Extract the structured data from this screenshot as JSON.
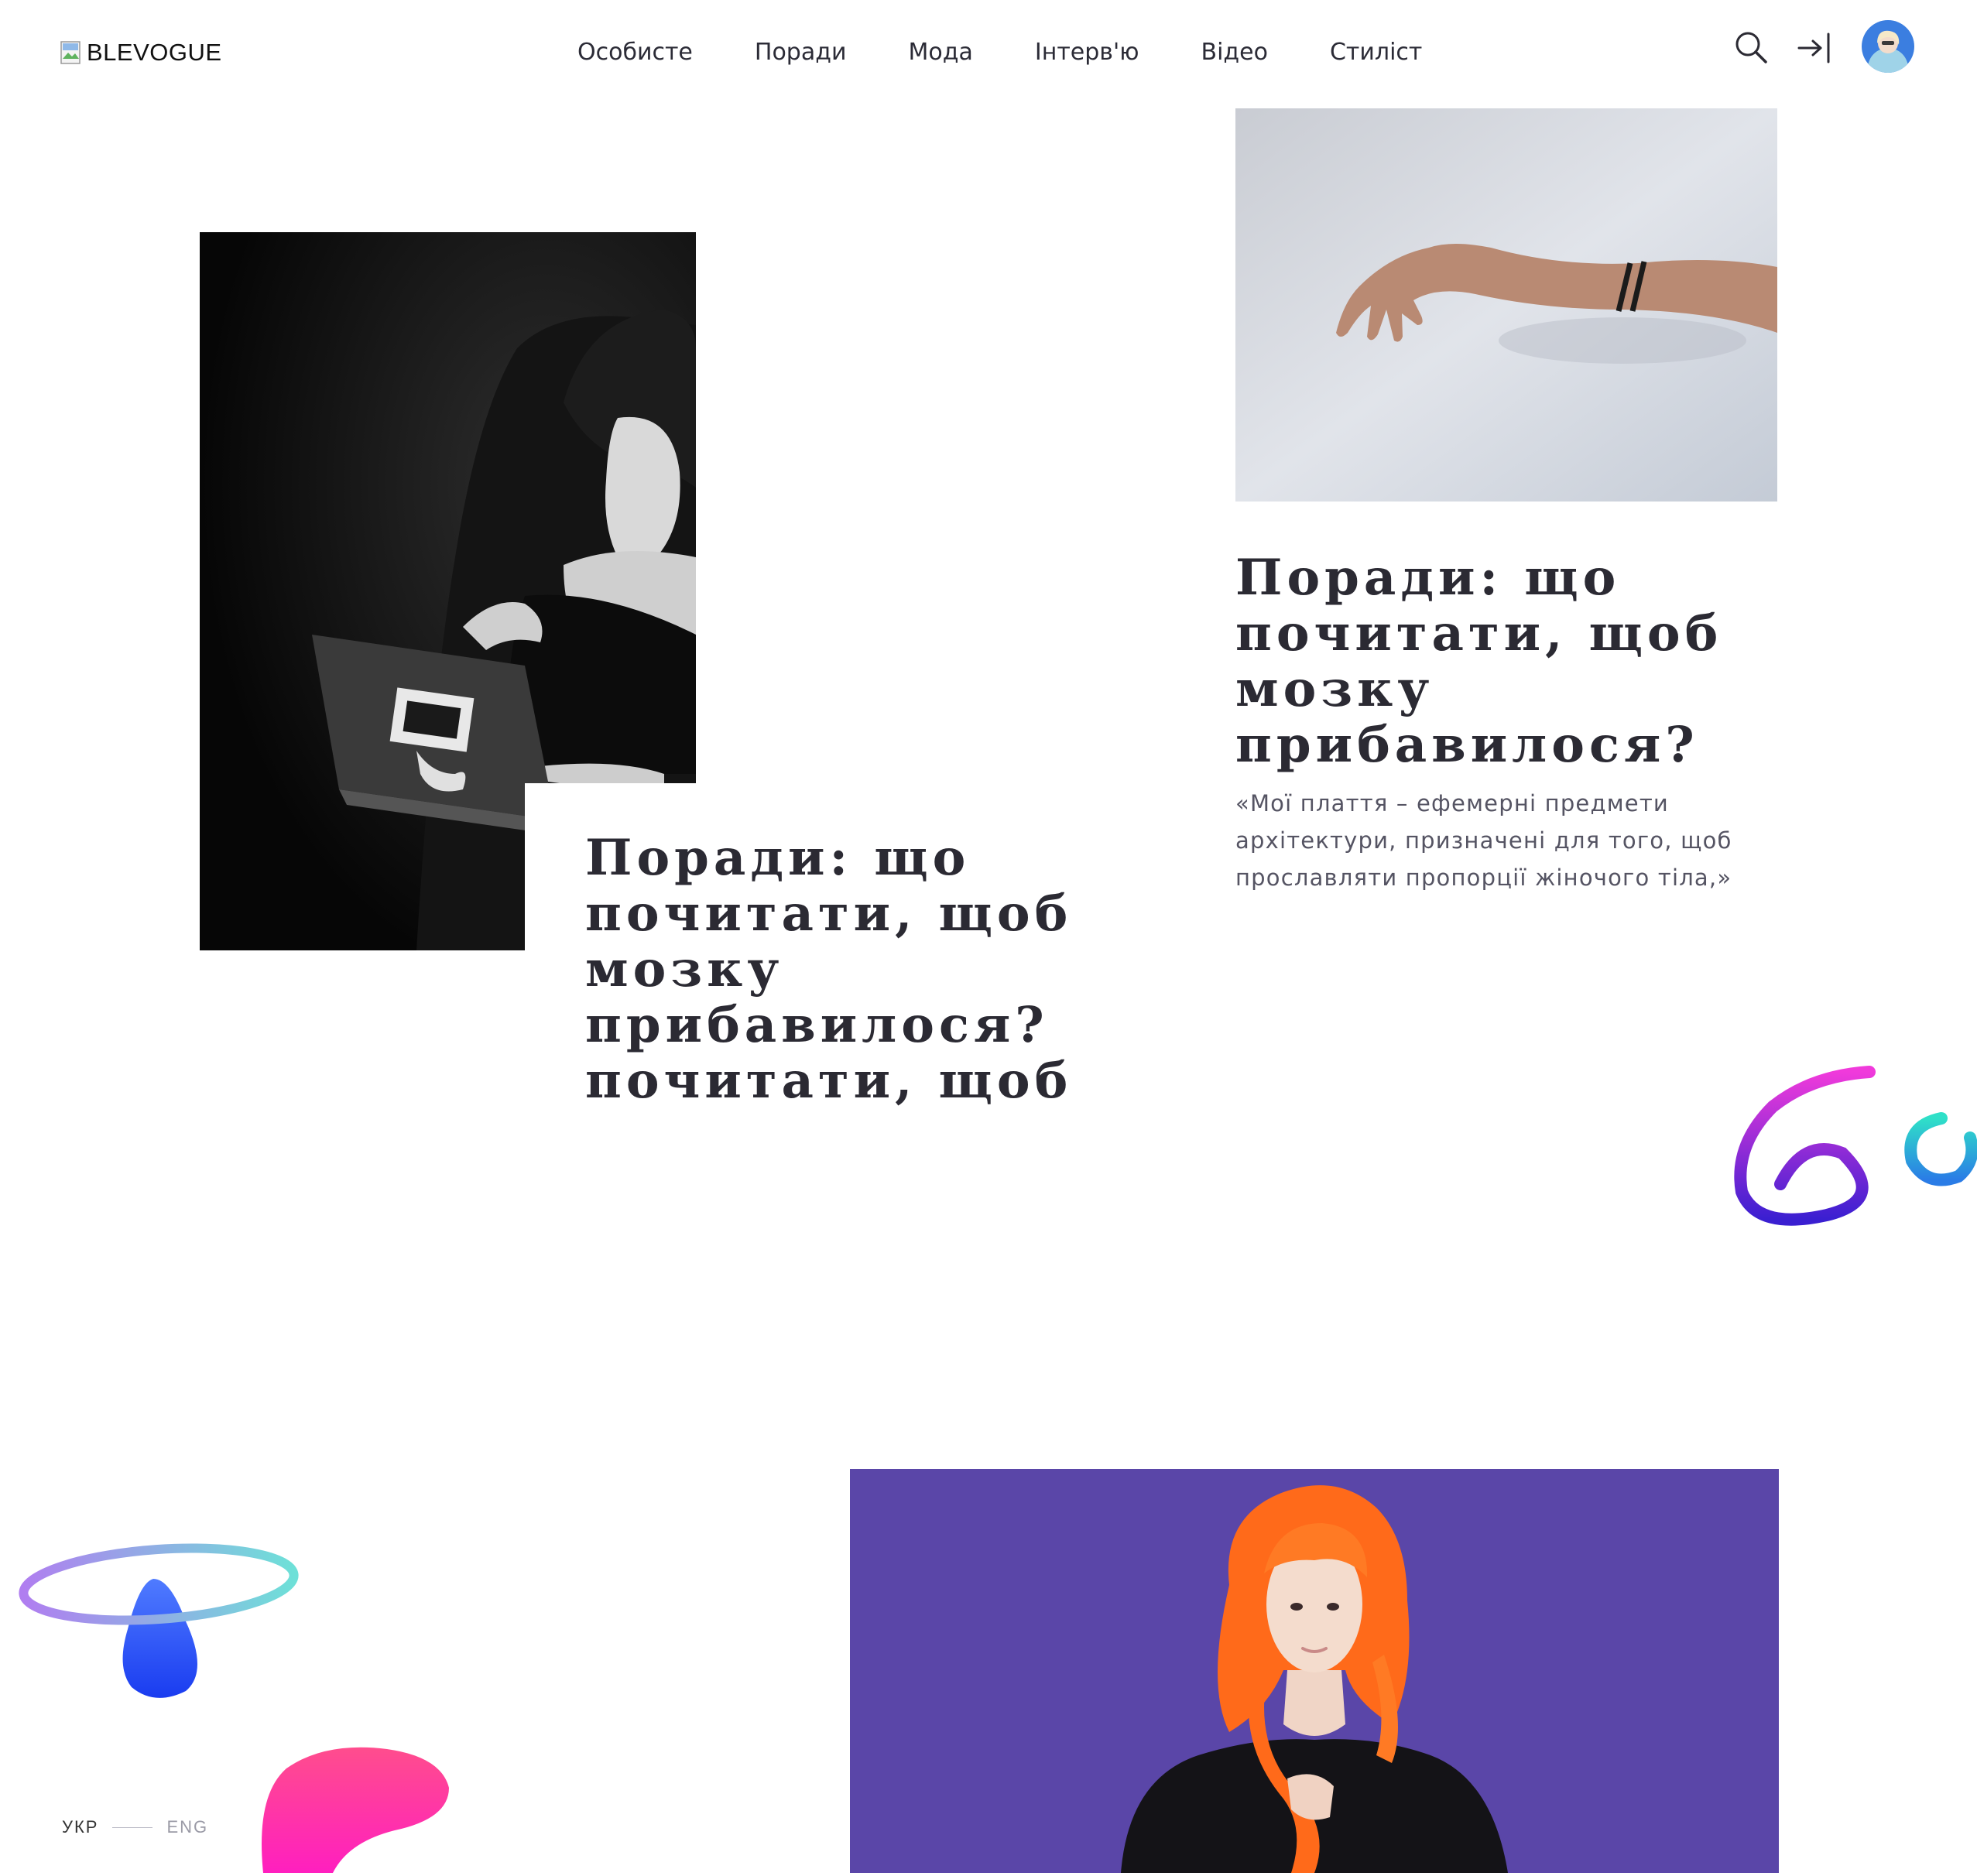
{
  "header": {
    "logo_text": "BLEVOGUE",
    "nav": [
      "Особисте",
      "Поради",
      "Мода",
      "Інтерв'ю",
      "Відео",
      "Стиліст"
    ]
  },
  "articles": [
    {
      "title": "Поради: що почитати, щоб мозку прибавилося? почитати, щоб",
      "title_lines": [
        "Поради: що",
        "почитати, щоб",
        "мозку",
        "прибавилося?",
        "почитати, щоб"
      ]
    },
    {
      "title": "Поради: що почитати, щоб мозку прибавилося?",
      "title_lines": [
        "Поради: що",
        "почитати, щоб",
        "мозку",
        "прибавилося?"
      ],
      "lede": "«Мої плаття – ефемерні предмети архітектури, призначені для того, щоб прославляти пропорції жіночого тіла,»",
      "lede_lines": [
        "«Мої плаття – ефемерні предмети",
        "архітектури, призначені для того, щоб",
        "прославляти пропорції жіночого тіла,»"
      ]
    }
  ],
  "language": {
    "current": "УКР",
    "other": "ENG"
  },
  "colors": {
    "accent_purple": "#5a46a8",
    "text_dark": "#2b2a33"
  }
}
